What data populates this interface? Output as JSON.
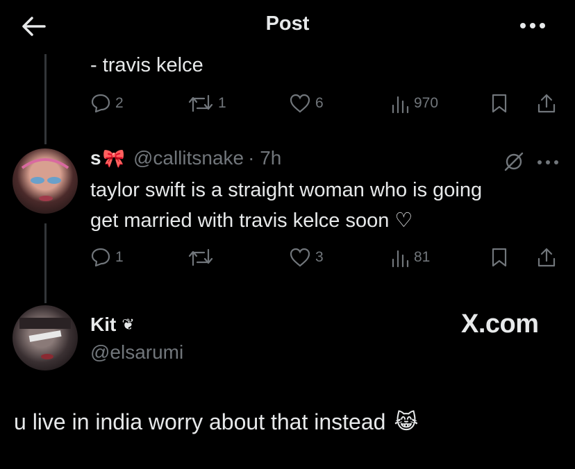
{
  "header": {
    "title": "Post"
  },
  "thread": [
    {
      "text": "- travis kelce",
      "stats": {
        "replies": "2",
        "reposts": "1",
        "likes": "6",
        "views": "970"
      }
    },
    {
      "author": {
        "name": "s",
        "emoji": "🎀",
        "handle": "@callitsnake",
        "time": "· 7h"
      },
      "text_lines": [
        "taylor swift is a straight woman who is going",
        "get married with travis kelce soon ♡"
      ],
      "stats": {
        "replies": "1",
        "reposts": "",
        "likes": "3",
        "views": "81"
      }
    }
  ],
  "reply": {
    "author": {
      "name": "Kit",
      "emoji": "❦",
      "handle": "@elsarumi"
    },
    "watermark": "X.com",
    "text": "u live in india worry about that instead",
    "emoji": "😹"
  },
  "colors": {
    "background": "#000000",
    "text": "#e7e9ea",
    "muted": "#71767b",
    "thread_line": "#333639"
  }
}
